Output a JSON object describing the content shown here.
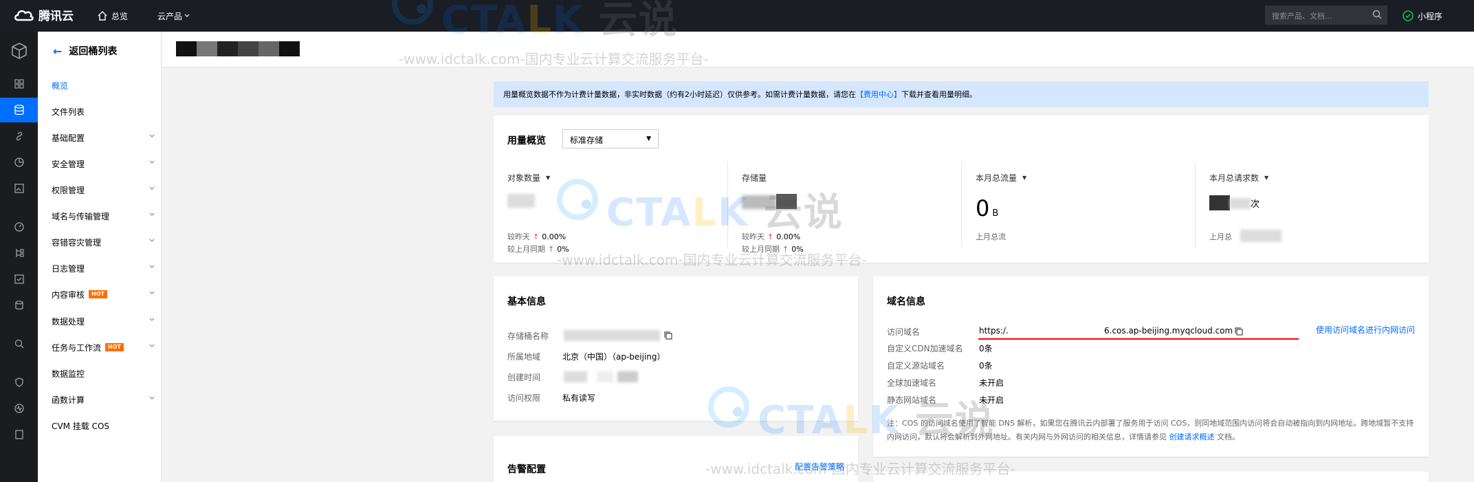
{
  "topbar": {
    "brand": "腾讯云",
    "overview": "总览",
    "products": "云产品",
    "search_placeholder": "搜索产品、文档...",
    "mini_program": "小程序"
  },
  "sidebar": {
    "back_label": "返回桶列表",
    "items": [
      {
        "label": "概览",
        "active": true
      },
      {
        "label": "文件列表"
      },
      {
        "label": "基础配置",
        "expandable": true
      },
      {
        "label": "安全管理",
        "expandable": true
      },
      {
        "label": "权限管理",
        "expandable": true
      },
      {
        "label": "域名与传输管理",
        "expandable": true
      },
      {
        "label": "容错容灾管理",
        "expandable": true
      },
      {
        "label": "日志管理",
        "expandable": true
      },
      {
        "label": "内容审核",
        "badge": "HOT",
        "expandable": true
      },
      {
        "label": "数据处理",
        "expandable": true
      },
      {
        "label": "任务与工作流",
        "badge": "HOT",
        "expandable": true
      },
      {
        "label": "数据监控"
      },
      {
        "label": "函数计算",
        "expandable": true
      },
      {
        "label": "CVM 挂载 COS"
      }
    ]
  },
  "notice": {
    "text": "用量概览数据不作为计费计量数据，非实时数据（约有2小时延迟）仅供参考。如需计费计量数据，请您在",
    "link": "【费用中心】",
    "text_after": "下载并查看用量明细。"
  },
  "usage": {
    "title": "用量概览",
    "storage_type": "标准存储",
    "metrics": [
      {
        "label": "对象数量",
        "dropdown": true,
        "cmp_day_label": "较昨天",
        "cmp_day": "0.00%",
        "cmp_month_label": "较上月同期",
        "cmp_month": "0%"
      },
      {
        "label": "存储量",
        "dropdown": false,
        "cmp_day_label": "较昨天",
        "cmp_day": "0.00%",
        "cmp_month_label": "较上月同期",
        "cmp_month": "0%"
      },
      {
        "label": "本月总流量",
        "dropdown": true,
        "value": "0",
        "unit": "B",
        "sub": "上月总流"
      },
      {
        "label": "本月总请求数",
        "dropdown": true,
        "unit": "次",
        "sub": "上月总"
      }
    ]
  },
  "basic": {
    "title": "基本信息",
    "rows": [
      {
        "key": "存储桶名称",
        "value": ""
      },
      {
        "key": "所属地域",
        "value": "北京（中国）（ap-beijing）"
      },
      {
        "key": "创建时间",
        "value": ""
      },
      {
        "key": "访问权限",
        "value": "私有读写"
      }
    ]
  },
  "domain": {
    "title": "域名信息",
    "rows": [
      {
        "key": "访问域名",
        "value_prefix": "https:/.",
        "value_suffix": "6.cos.ap-beijing.myqcloud.com"
      },
      {
        "key": "自定义CDN加速域名",
        "value": "0条"
      },
      {
        "key": "自定义源站域名",
        "value": "0条"
      },
      {
        "key": "全球加速域名",
        "value": "未开启"
      },
      {
        "key": "静态网站域名",
        "value": "未开启"
      }
    ],
    "action_link": "使用访问域名进行内网访问",
    "note_text": "注：COS 的访问域名使用了智能 DNS 解析，如果您在腾讯云内部署了服务用于访问 COS，则同地域范围内访问将会自动被指向到内网地址。跨地域暂不支持内网访问，默认将会解析到外网地址。有关内网与外网访问的相关信息，详情请参见",
    "note_link": "创建请求概述",
    "note_after": "文档。"
  },
  "alarm": {
    "title": "告警配置",
    "link": "配置告警策略"
  },
  "watermark": {
    "brand_letter": "C",
    "brand_ta": "TA",
    "brand_l": "L",
    "brand_k": "K",
    "brand_cn": "云说",
    "url": "-www.idctalk.com-国内专业云计算交流服务平台-"
  },
  "colors": {
    "accent": "#006eff",
    "topbar": "#1a1d24",
    "rail": "#1b1c1f",
    "hot": "#ff6e00",
    "notice_bg": "#d5e7ff",
    "highlight": "#ff0000"
  }
}
